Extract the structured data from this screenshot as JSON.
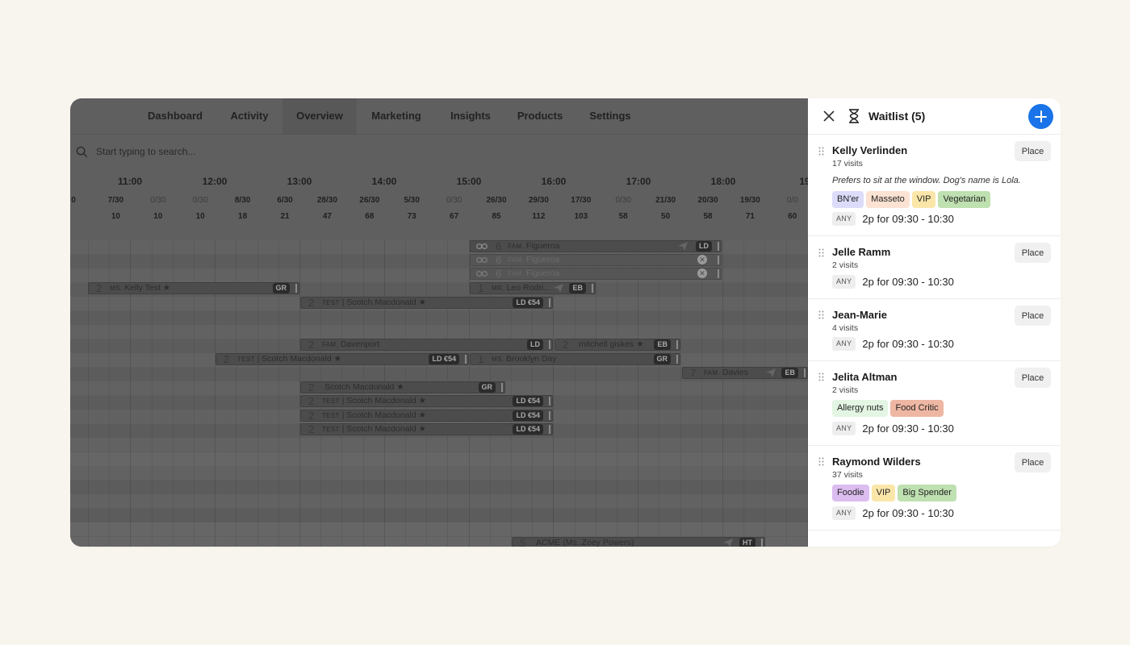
{
  "nav": {
    "tabs": [
      {
        "label": "Dashboard",
        "active": false
      },
      {
        "label": "Activity",
        "active": false
      },
      {
        "label": "Overview",
        "active": true
      },
      {
        "label": "Marketing",
        "active": false
      },
      {
        "label": "Insights",
        "active": false
      },
      {
        "label": "Products",
        "active": false
      },
      {
        "label": "Settings",
        "active": false
      }
    ]
  },
  "search": {
    "placeholder": "Start typing to search..."
  },
  "timeline": {
    "hours": [
      "11:00",
      "12:00",
      "13:00",
      "14:00",
      "15:00",
      "16:00",
      "17:00",
      "18:00",
      "19:"
    ],
    "capacity": [
      "0",
      "7/30",
      "0/30",
      "0/30",
      "8/30",
      "6/30",
      "28/30",
      "26/30",
      "5/30",
      "0/30",
      "26/30",
      "29/30",
      "17/30",
      "0/30",
      "21/30",
      "20/30",
      "19/30",
      "0/0"
    ],
    "covers": [
      "",
      "10",
      "10",
      "10",
      "18",
      "21",
      "47",
      "68",
      "73",
      "67",
      "85",
      "112",
      "103",
      "58",
      "50",
      "58",
      "71",
      "60"
    ]
  },
  "bookings": [
    {
      "count": "6",
      "prefix": "FAM.",
      "name": "Figueroa",
      "tag": "LD",
      "faded": false
    },
    {
      "count": "6",
      "prefix": "FAM.",
      "name": "Figueroa",
      "tag": "",
      "faded": true
    },
    {
      "count": "6",
      "prefix": "FAM.",
      "name": "Figueroa",
      "tag": "",
      "faded": true
    },
    {
      "count": "2",
      "prefix": "MS.",
      "name": "Kelly Test ★",
      "tag": "GR",
      "faded": false
    },
    {
      "count": "1",
      "prefix": "MR.",
      "name": "Leo Rodri...",
      "tag": "EB",
      "faded": false
    },
    {
      "count": "2",
      "prefix": "TEST",
      "name": "| Scotch Macdonald ★",
      "tag": "LD €54",
      "faded": false
    },
    {
      "count": "2",
      "prefix": "FAM.",
      "name": "Davenport",
      "tag": "LD",
      "faded": false
    },
    {
      "count": "2",
      "prefix": "",
      "name": "mitchell giskes ★",
      "tag": "EB",
      "faded": false
    },
    {
      "count": "2",
      "prefix": "TEST",
      "name": "| Scotch Macdonald ★",
      "tag": "LD €54",
      "faded": false
    },
    {
      "count": "1",
      "prefix": "MS.",
      "name": "Brooklyn Day",
      "tag": "GR",
      "faded": false
    },
    {
      "count": "7",
      "prefix": "FAM.",
      "name": "Davies",
      "tag": "EB",
      "faded": false
    },
    {
      "count": "2",
      "prefix": "",
      "name": "Scotch Macdonald ★",
      "tag": "GR",
      "faded": false
    },
    {
      "count": "2",
      "prefix": "TEST",
      "name": "| Scotch Macdonald ★",
      "tag": "LD €54",
      "faded": false
    },
    {
      "count": "2",
      "prefix": "TEST",
      "name": "| Scotch Macdonald ★",
      "tag": "LD €54",
      "faded": false
    },
    {
      "count": "2",
      "prefix": "TEST",
      "name": "| Scotch Macdonald ★",
      "tag": "LD €54",
      "faded": false
    },
    {
      "count": "5",
      "prefix": "",
      "name": "ACME (Ms. Zoey Powers)",
      "tag": "HT",
      "faded": false
    }
  ],
  "waitlist": {
    "title": "Waitlist (5)",
    "place_label": "Place",
    "any_label": "ANY",
    "items": [
      {
        "name": "Kelly Verlinden",
        "visits": "17 visits",
        "note": "Prefers to sit at the window. Dog's name is Lola.",
        "tags": [
          {
            "label": "BN'er",
            "color": "#dcdcfa"
          },
          {
            "label": "Masseto",
            "color": "#fbe2d2"
          },
          {
            "label": "VIP",
            "color": "#fbe6a9"
          },
          {
            "label": "Vegetarian",
            "color": "#bfe0b0"
          }
        ],
        "slot": "2p for 09:30 - 10:30"
      },
      {
        "name": "Jelle Ramm",
        "visits": "2 visits",
        "note": "",
        "tags": [],
        "slot": "2p for 09:30 - 10:30"
      },
      {
        "name": "Jean-Marie",
        "visits": "4 visits",
        "note": "",
        "tags": [],
        "slot": "2p for 09:30 - 10:30"
      },
      {
        "name": "Jelita Altman",
        "visits": "2 visits",
        "note": "",
        "tags": [
          {
            "label": "Allergy nuts",
            "color": "#e3f5e3"
          },
          {
            "label": "Food Critic",
            "color": "#eeb7a3"
          }
        ],
        "slot": "2p for 09:30 - 10:30"
      },
      {
        "name": "Raymond Wilders",
        "visits": "37 visits",
        "note": "",
        "tags": [
          {
            "label": "Foodie",
            "color": "#dcbdf0"
          },
          {
            "label": "VIP",
            "color": "#fbe6a9"
          },
          {
            "label": "Big Spender",
            "color": "#bfe0b0"
          }
        ],
        "slot": "2p for 09:30 - 10:30"
      }
    ]
  },
  "colors": {
    "accent": "#1a73e8",
    "overlay": "#5f5f5f"
  }
}
